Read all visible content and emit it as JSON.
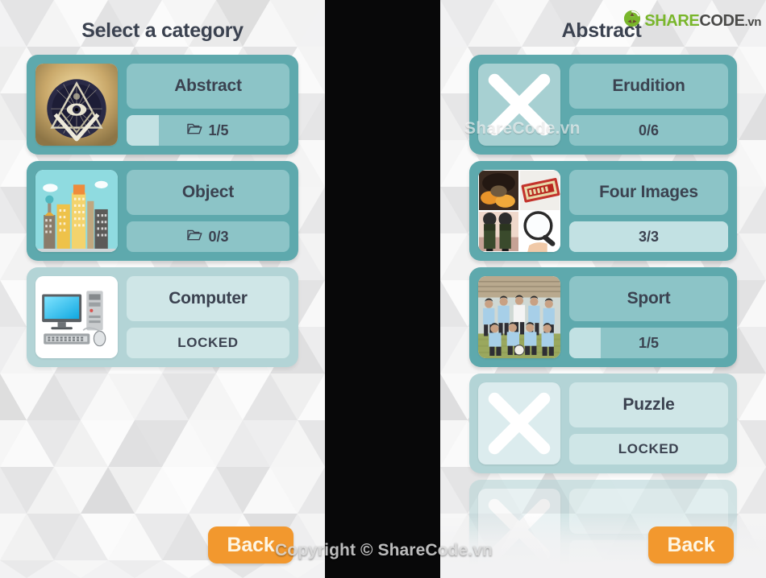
{
  "left_panel": {
    "title": "Select a category",
    "back_label": "Back",
    "cards": [
      {
        "name": "Abstract",
        "progress_label": "1/5",
        "progress_pct": 20,
        "locked": false,
        "has_folder_icon": true,
        "thumb": "eye-pyramid-art"
      },
      {
        "name": "Object",
        "progress_label": "0/3",
        "progress_pct": 0,
        "locked": false,
        "has_folder_icon": true,
        "thumb": "city-buildings-art"
      },
      {
        "name": "Computer",
        "progress_label": "LOCKED",
        "progress_pct": 0,
        "locked": true,
        "has_folder_icon": false,
        "thumb": "desktop-computer-art"
      }
    ]
  },
  "right_panel": {
    "title": "Abstract",
    "back_label": "Back",
    "cards": [
      {
        "name": "Erudition",
        "progress_label": "0/6",
        "progress_pct": 0,
        "locked": false,
        "has_folder_icon": false,
        "thumb": "missing-image-x"
      },
      {
        "name": "Four Images",
        "progress_label": "3/3",
        "progress_pct": 100,
        "locked": false,
        "has_folder_icon": false,
        "thumb": "four-images-collage"
      },
      {
        "name": "Sport",
        "progress_label": "1/5",
        "progress_pct": 20,
        "locked": false,
        "has_folder_icon": false,
        "thumb": "football-team-photo"
      },
      {
        "name": "Puzzle",
        "progress_label": "LOCKED",
        "progress_pct": 0,
        "locked": true,
        "has_folder_icon": false,
        "thumb": "missing-image-x"
      },
      {
        "name": "",
        "progress_label": "",
        "progress_pct": 0,
        "locked": true,
        "has_folder_icon": false,
        "thumb": "missing-image-x",
        "partial": true
      }
    ]
  },
  "logo": {
    "share": "SHARE",
    "code": "CODE",
    "vn": ".vn"
  },
  "watermarks": {
    "center": "ShareCode.vn",
    "bottom": "Copyright © ShareCode.vn"
  },
  "colors": {
    "card": "#5ea9ad",
    "card_locked": "#b3d4d6",
    "bar": "#8cc4c7",
    "bar_fill": "#c2e1e3",
    "text": "#3b4250",
    "accent_orange": "#f2982e",
    "logo_green": "#79b62b",
    "background": "#f2f2f3"
  }
}
